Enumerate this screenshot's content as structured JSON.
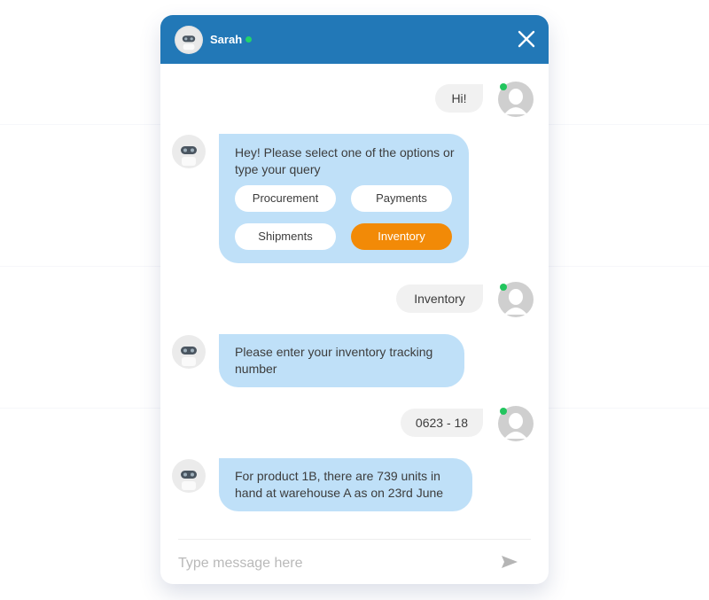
{
  "header": {
    "agent_name": "Sarah",
    "status": "online",
    "close_icon": "close-icon"
  },
  "messages": [
    {
      "from": "user",
      "text": "Hi!"
    },
    {
      "from": "bot",
      "text": "Hey! Please select one of the options or type your query",
      "options": [
        {
          "label": "Procurement",
          "selected": false
        },
        {
          "label": "Payments",
          "selected": false
        },
        {
          "label": "Shipments",
          "selected": false
        },
        {
          "label": "Inventory",
          "selected": true
        }
      ]
    },
    {
      "from": "user",
      "text": "Inventory"
    },
    {
      "from": "bot",
      "text": "Please enter your inventory tracking number"
    },
    {
      "from": "user",
      "text": "0623 - 18"
    },
    {
      "from": "bot",
      "text": "For product 1B, there are 739 units in hand at warehouse A as on 23rd June"
    }
  ],
  "composer": {
    "placeholder": "Type message here",
    "value": "",
    "send_icon": "send-icon"
  },
  "colors": {
    "header": "#2278b7",
    "bot_bubble": "#bfe0f8",
    "user_bubble": "#f1f1f1",
    "selected_option": "#f28a07",
    "online": "#22d36b"
  }
}
